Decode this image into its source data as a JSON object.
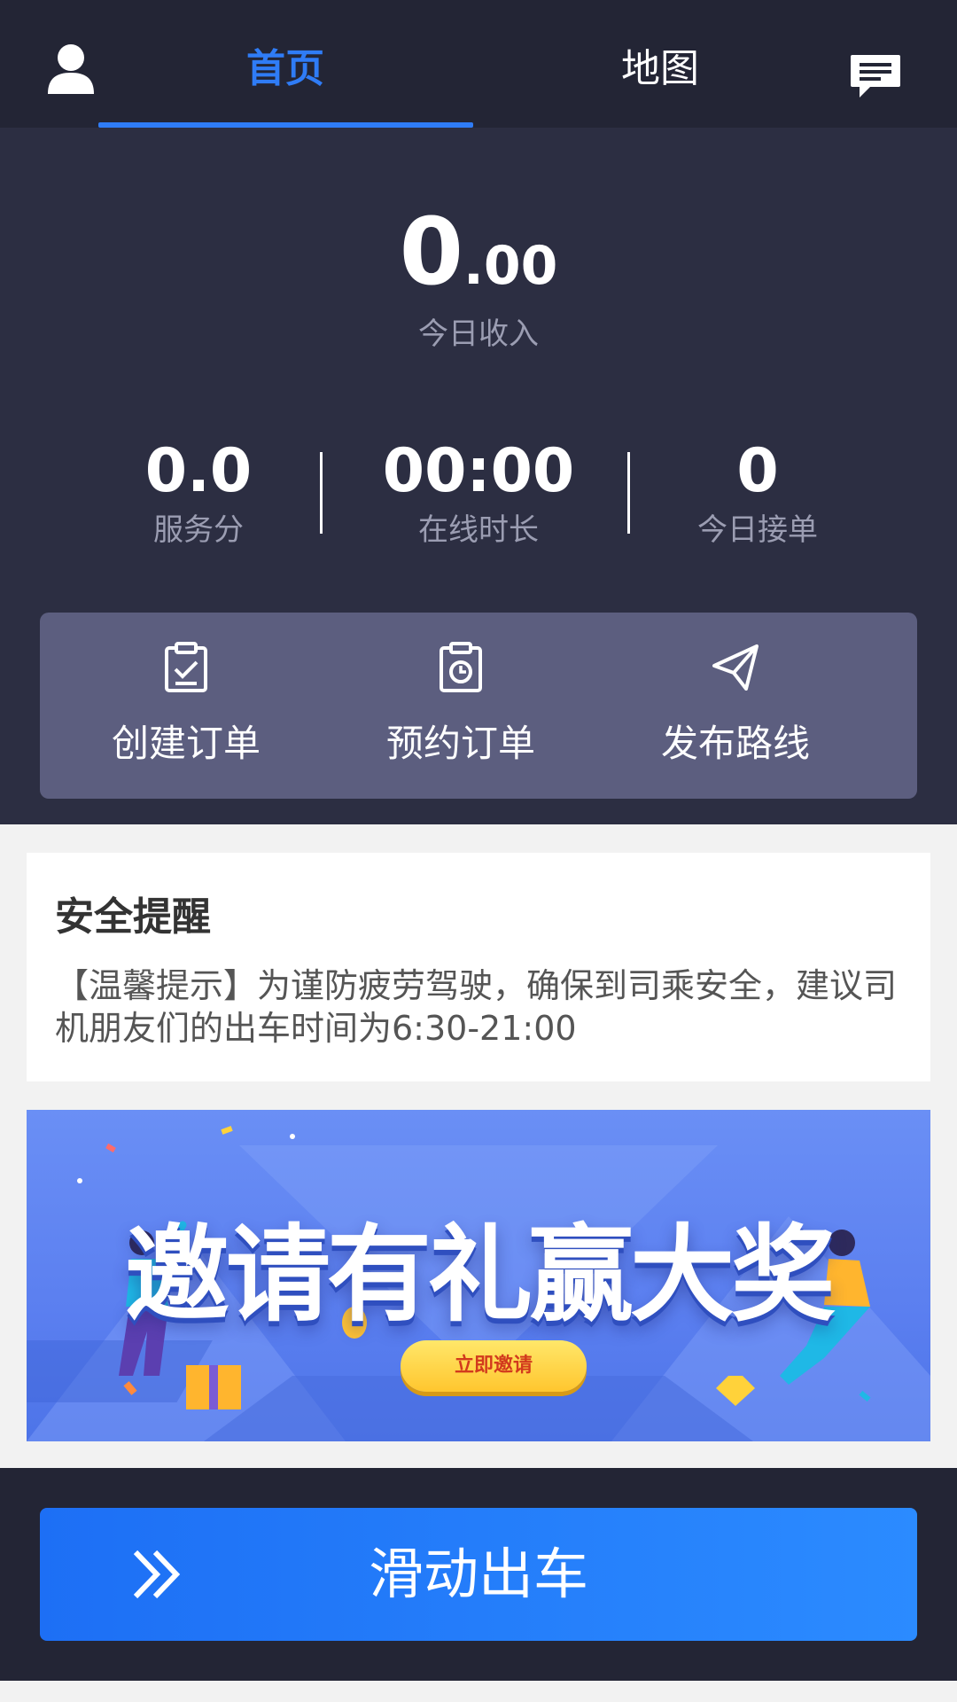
{
  "nav": {
    "tabs": [
      {
        "label": "首页",
        "active": true
      },
      {
        "label": "地图",
        "active": false
      }
    ],
    "profile_icon": "user-icon",
    "message_icon": "message-icon"
  },
  "dashboard": {
    "income_int": "0",
    "income_dec": ".00",
    "income_label": "今日收入",
    "stats": [
      {
        "value": "0.0",
        "label": "服务分"
      },
      {
        "value": "00:00",
        "label": "在线时长"
      },
      {
        "value": "0",
        "label": "今日接单"
      }
    ],
    "actions": [
      {
        "label": "创建订单",
        "icon": "clipboard-check-icon"
      },
      {
        "label": "预约订单",
        "icon": "clipboard-clock-icon"
      },
      {
        "label": "发布路线",
        "icon": "paper-plane-icon"
      }
    ]
  },
  "safety": {
    "title": "安全提醒",
    "text": "【温馨提示】为谨防疲劳驾驶，确保到司乘安全，建议司机朋友们的出车时间为6:30-21:00"
  },
  "banner": {
    "title": "邀请有礼赢大奖",
    "button": "立即邀请"
  },
  "go": {
    "label": "滑动出车",
    "icon": "double-chevron-right-icon"
  },
  "colors": {
    "accent": "#2f7cf6",
    "topbar": "#232535",
    "panel": "#2c2e42",
    "actions_bg": "#5c5e7f"
  }
}
